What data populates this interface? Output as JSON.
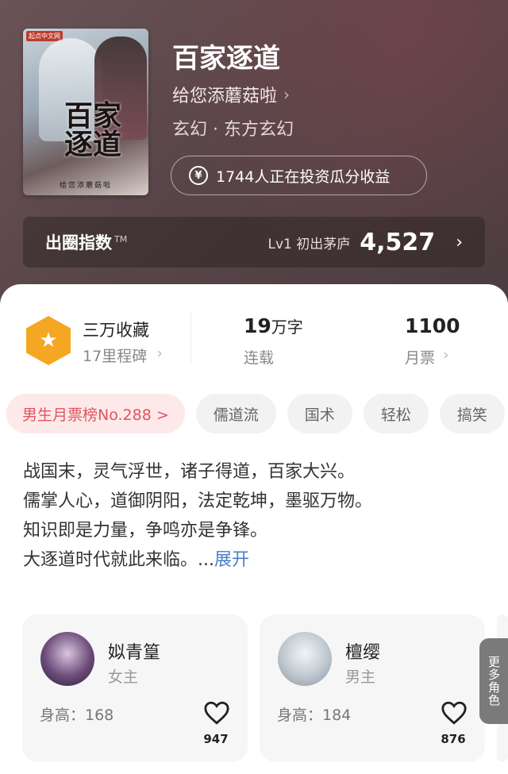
{
  "book": {
    "title": "百家逐道",
    "author": "给您添蘑菇啦",
    "genre": "玄幻 · 东方玄幻",
    "invest_text": "1744人正在投资瓜分收益",
    "cover": {
      "badge": "起点中文网",
      "title_text": "百家逐道",
      "author_text": "给您添蘑菇啦"
    }
  },
  "circle_index": {
    "label": "出圈指数",
    "tm": "TM",
    "level": "Lv1 初出茅庐",
    "score": "4,527"
  },
  "stats": {
    "collect_main": "三万收藏",
    "collect_sub": "17里程碑",
    "words_num": "19",
    "words_unit": "万字",
    "words_sub": "连载",
    "tickets_main": "1100",
    "tickets_sub": "月票"
  },
  "tags": [
    {
      "label": "男生月票榜No.288 >"
    },
    {
      "label": "儒道流"
    },
    {
      "label": "国术"
    },
    {
      "label": "轻松"
    },
    {
      "label": "搞笑"
    }
  ],
  "description": {
    "lines": [
      "战国末，灵气浮世，诸子得道，百家大兴。",
      "儒掌人心，道御阴阳，法定乾坤，墨驱万物。",
      "知识即是力量，争鸣亦是争锋。",
      "大逐道时代就此来临。..."
    ],
    "expand": "展开"
  },
  "characters": [
    {
      "name": "姒青篁",
      "role": "女主",
      "height": "身高：168",
      "likes": "947"
    },
    {
      "name": "檀缨",
      "role": "男主",
      "height": "身高：184",
      "likes": "876"
    }
  ],
  "more_roles": "更多角色",
  "icons": {
    "author_chevron": "chevron-right-icon",
    "yen": "yen-icon",
    "star": "star-icon",
    "heart": "heart-icon"
  },
  "colors": {
    "rank_tag_bg": "#fde9e9",
    "rank_tag_text": "#e05560",
    "expand_link": "#4a7ec8",
    "hexagon": "#f5a623"
  }
}
